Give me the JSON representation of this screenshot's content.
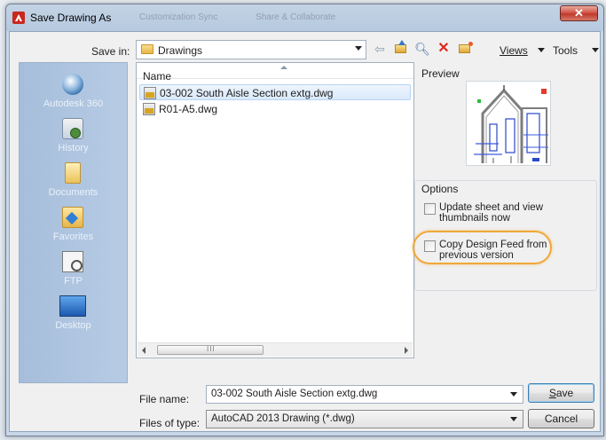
{
  "window": {
    "title": "Save Drawing As",
    "close_glyph": "✕",
    "background_tabs": [
      "Customization Sync",
      "Share & Collaborate"
    ]
  },
  "toolbar": {
    "save_in_label": "Save in:",
    "save_in_value": "Drawings",
    "views_label": "Views",
    "tools_label": "Tools",
    "icons": [
      "back-icon",
      "up-folder-icon",
      "search-web-icon",
      "delete-icon",
      "create-folder-icon"
    ]
  },
  "places": [
    {
      "label": "Autodesk 360",
      "icon": "cloud-icon"
    },
    {
      "label": "History",
      "icon": "history-icon"
    },
    {
      "label": "Documents",
      "icon": "documents-icon"
    },
    {
      "label": "Favorites",
      "icon": "favorites-icon"
    },
    {
      "label": "FTP",
      "icon": "ftp-icon"
    },
    {
      "label": "Desktop",
      "icon": "desktop-icon"
    }
  ],
  "file_list": {
    "column_name": "Name",
    "files": [
      {
        "name": "03-002 South Aisle Section extg.dwg",
        "selected": true
      },
      {
        "name": "R01-A5.dwg",
        "selected": false
      }
    ],
    "scroll_grip": "III"
  },
  "preview": {
    "label": "Preview"
  },
  "options": {
    "label": "Options",
    "update_thumbnails": {
      "label": "Update sheet and view thumbnails now",
      "checked": false
    },
    "copy_design_feed": {
      "label": "Copy Design Feed from previous version",
      "checked": false
    }
  },
  "bottom": {
    "file_name_label": "File name:",
    "file_name_value": "03-002 South Aisle Section extg.dwg",
    "file_type_label": "Files of type:",
    "file_type_value": "AutoCAD 2013 Drawing (*.dwg)",
    "save_label_underlined": "S",
    "save_label_rest": "ave",
    "cancel_label": "Cancel"
  },
  "colors": {
    "highlight_ring": "#f0a838",
    "places_bar": "#a6bedb",
    "selection": "#d9e9fb"
  }
}
